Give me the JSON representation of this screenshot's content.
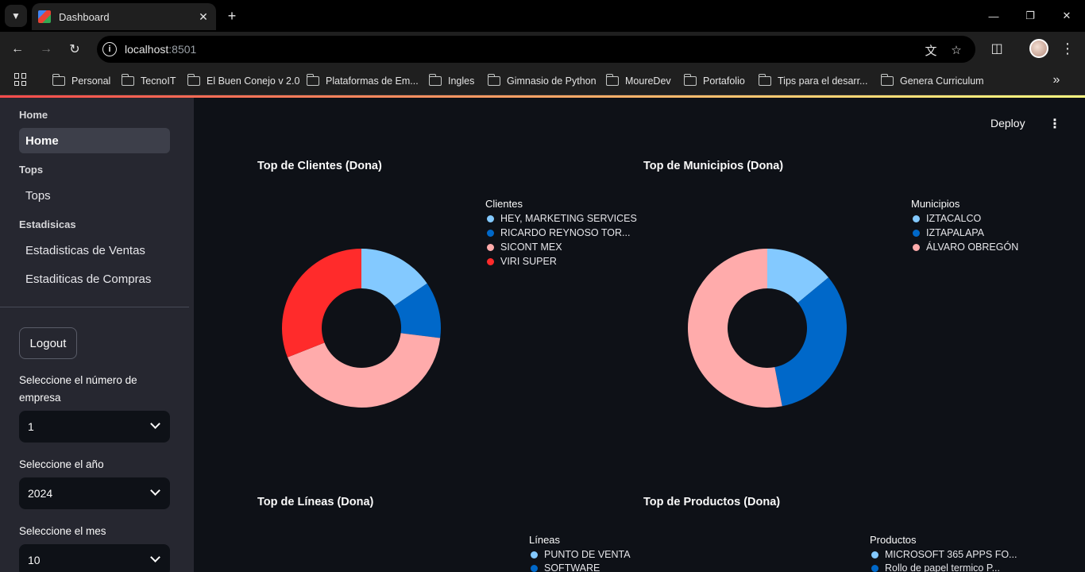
{
  "browser": {
    "tab_title": "Dashboard",
    "url_host": "localhost",
    "url_port": ":8501",
    "bookmarks": [
      "Personal",
      "TecnoIT",
      "El Buen Conejo v 2.0",
      "Plataformas de Em...",
      "Ingles",
      "Gimnasio de Python",
      "MoureDev",
      "Portafolio",
      "Tips para el desarr...",
      "Genera Curriculum"
    ]
  },
  "sidebar": {
    "sections": [
      {
        "title": "Home",
        "links": [
          {
            "label": "Home",
            "active": true
          }
        ]
      },
      {
        "title": "Tops",
        "links": [
          {
            "label": "Tops",
            "active": false
          }
        ]
      },
      {
        "title": "Estadisicas",
        "links": [
          {
            "label": "Estadisticas de Ventas",
            "active": false
          },
          {
            "label": "Estaditicas de Compras",
            "active": false
          }
        ]
      }
    ],
    "logout_label": "Logout",
    "empresa_label": "Seleccione el número de empresa",
    "empresa_value": "1",
    "anio_label": "Seleccione el año",
    "anio_value": "2024",
    "mes_label": "Seleccione el mes",
    "mes_value": "10"
  },
  "header": {
    "deploy_label": "Deploy"
  },
  "colors": {
    "light_blue": "#83c9ff",
    "blue": "#0068c9",
    "pink": "#ffabab",
    "red": "#ff2b2b"
  },
  "chart_data": [
    {
      "type": "pie",
      "variant": "donut",
      "title": "Top de Clientes (Dona)",
      "legend_title": "Clientes",
      "categories": [
        "HEY, MARKETING SERVICES",
        "RICARDO REYNOSO TOR...",
        "SICONT MEX",
        "VIRI SUPER"
      ],
      "values": [
        15.5,
        11.5,
        42,
        31
      ],
      "colors": [
        "#83c9ff",
        "#0068c9",
        "#ffabab",
        "#ff2b2b"
      ],
      "legend_placement": "right"
    },
    {
      "type": "pie",
      "variant": "donut",
      "title": "Top de Municipios (Dona)",
      "legend_title": "Municipios",
      "categories": [
        "IZTACALCO",
        "IZTAPALAPA",
        "ÁLVARO OBREGÓN"
      ],
      "values": [
        14,
        33,
        53
      ],
      "colors": [
        "#83c9ff",
        "#0068c9",
        "#ffabab"
      ],
      "legend_placement": "right"
    },
    {
      "type": "pie",
      "variant": "donut",
      "title": "Top de Líneas (Dona)",
      "legend_title": "Líneas",
      "categories": [
        "PUNTO DE VENTA",
        "SOFTWARE"
      ],
      "colors": [
        "#83c9ff",
        "#0068c9"
      ],
      "legend_placement": "right"
    },
    {
      "type": "pie",
      "variant": "donut",
      "title": "Top de Productos (Dona)",
      "legend_title": "Productos",
      "categories": [
        "MICROSOFT 365 APPS FO...",
        "Rollo de papel termico P..."
      ],
      "colors": [
        "#83c9ff",
        "#0068c9"
      ],
      "legend_placement": "right"
    }
  ]
}
